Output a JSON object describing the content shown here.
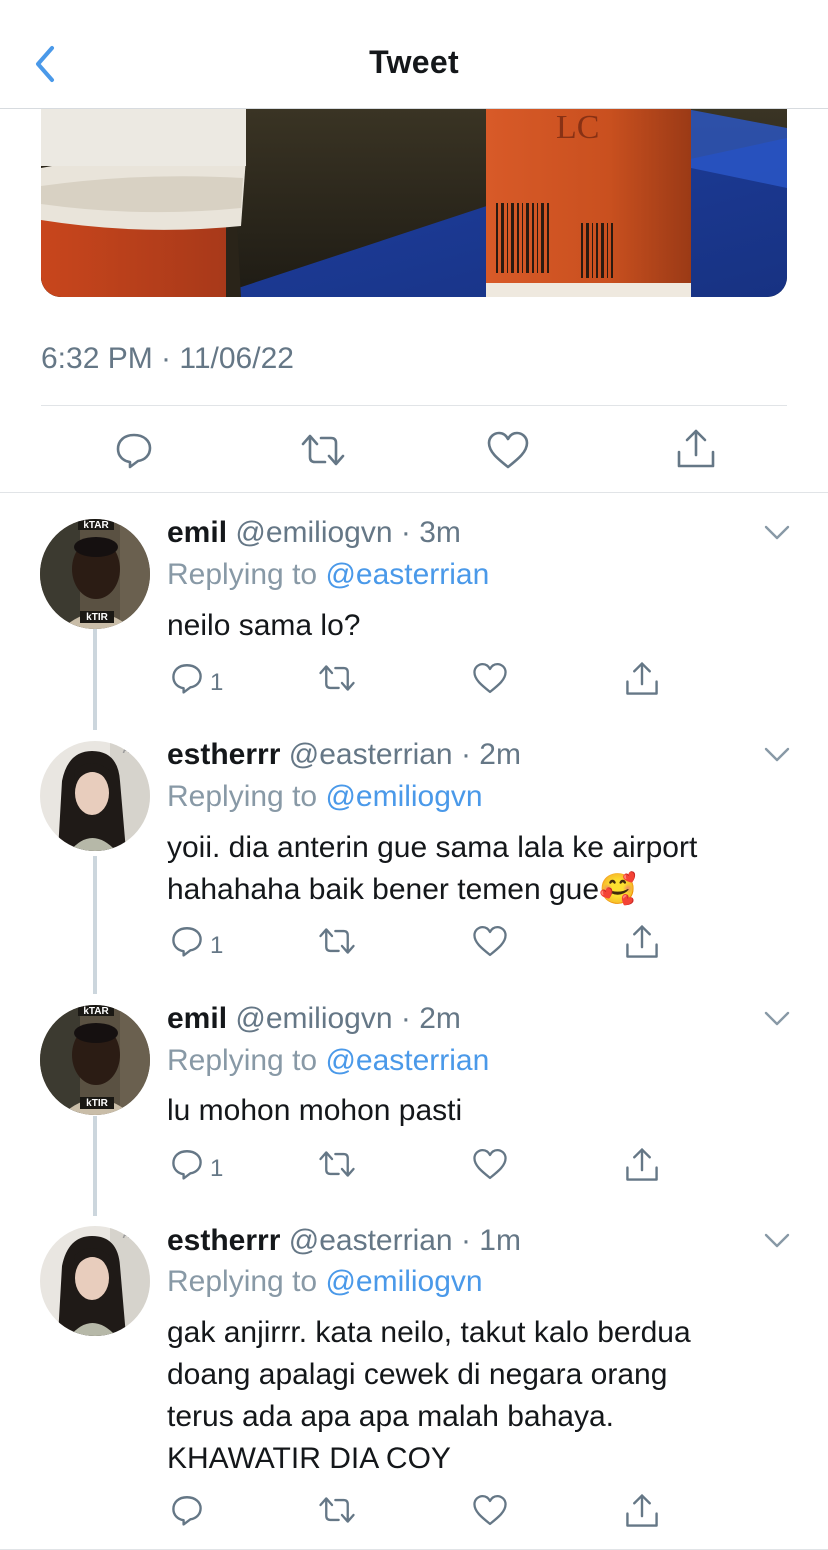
{
  "header": {
    "title": "Tweet",
    "back_icon": "chevron-left-icon"
  },
  "tweet": {
    "timestamp": "6:32 PM · 11/06/22"
  },
  "colors": {
    "accent": "#4a99e9",
    "secondary_text": "#657786"
  },
  "replies": [
    {
      "name": "emil",
      "handle": "@emiliogvn",
      "time": "· 3m",
      "replying_prefix": "Replying to",
      "replying_to": "@easterrian",
      "text_lines": [
        "neilo sama lo?"
      ],
      "reply_count": "1",
      "avatar_top_label": "kTAR",
      "avatar_bottom_label": "kTIR"
    },
    {
      "name": "estherrr",
      "handle": "@easterrian",
      "time": "· 2m",
      "replying_prefix": "Replying to",
      "replying_to": "@emiliogvn",
      "text_lines": [
        "yoii. dia anterin gue sama lala ke airport",
        "hahahaha baik bener temen gue🥰"
      ],
      "reply_count": "1",
      "avatar_top_label": "AQL"
    },
    {
      "name": "emil",
      "handle": "@emiliogvn",
      "time": "· 2m",
      "replying_prefix": "Replying to",
      "replying_to": "@easterrian",
      "text_lines": [
        "lu mohon mohon pasti"
      ],
      "reply_count": "1",
      "avatar_top_label": "kTAR",
      "avatar_bottom_label": "kTIR"
    },
    {
      "name": "estherrr",
      "handle": "@easterrian",
      "time": "· 1m",
      "replying_prefix": "Replying to",
      "replying_to": "@emiliogvn",
      "text_lines": [
        "gak anjirrr. kata neilo, takut kalo berdua",
        "doang apalagi cewek di negara orang",
        "terus ada apa apa malah bahaya.",
        "KHAWATIR DIA COY"
      ],
      "reply_count": "",
      "avatar_top_label": "AQL"
    }
  ]
}
